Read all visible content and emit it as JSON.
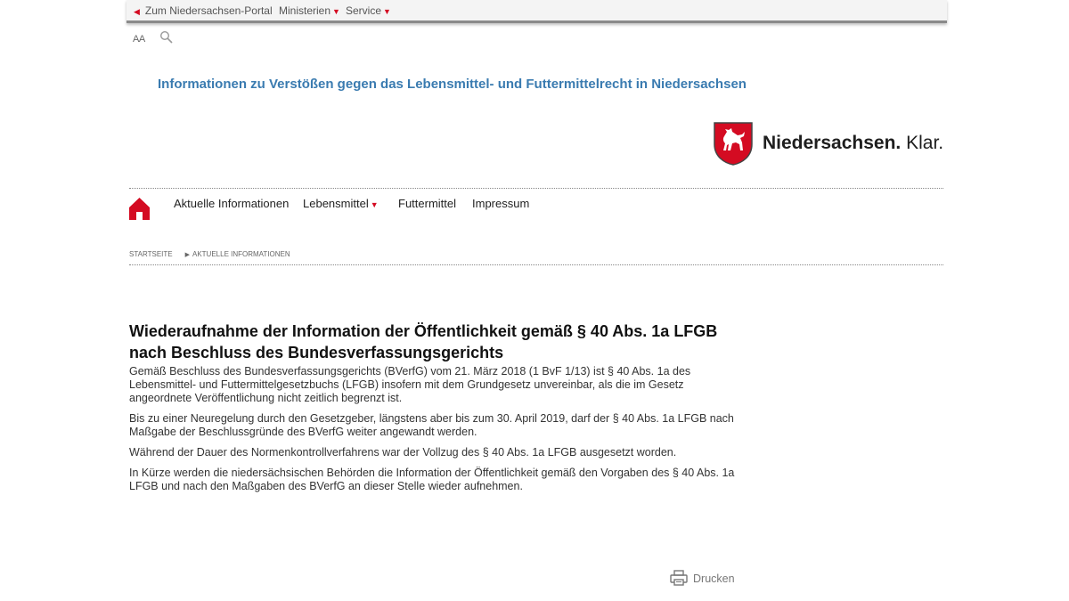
{
  "topbar": {
    "portal_label": "Zum Niedersachsen-Portal",
    "ministries_label": "Ministerien",
    "service_label": "Service"
  },
  "tools": {
    "font_size_label": "AA"
  },
  "site": {
    "tagline": "Informationen zu Verstößen gegen das Lebensmittel- und Futtermittelrecht in Niedersachsen",
    "logo_name": "Niedersachsen.",
    "logo_claim": "Klar."
  },
  "nav": {
    "items": [
      "Aktuelle Informationen",
      "Lebensmittel",
      "Futtermittel",
      "Impressum"
    ]
  },
  "breadcrumb": [
    "Startseite",
    "Aktuelle Informationen"
  ],
  "article": {
    "title": "Wiederaufnahme der Information der Öffentlichkeit gemäß § 40 Abs. 1a LFGB nach Beschluss des Bundesverfassungsgerichts",
    "paragraphs": [
      "Gemäß Beschluss des Bundesverfassungsgerichts (BVerfG) vom 21. März 2018 (1 BvF 1/13) ist § 40 Abs. 1a des Lebensmittel- und Futtermittelgesetzbuchs (LFGB) insofern mit dem Grundgesetz unvereinbar, als die im Gesetz angeordnete Veröffentlichung nicht zeitlich begrenzt ist.",
      "Bis zu einer Neuregelung durch den Gesetzgeber, längstens aber bis zum 30. April 2019, darf der § 40 Abs. 1a LFGB nach Maßgabe der Beschlussgründe des BVerfG weiter angewandt werden.",
      "Während der Dauer des Normenkontrollverfahrens war der Vollzug des § 40 Abs. 1a LFGB ausgesetzt worden.",
      "In Kürze werden die niedersächsischen Behörden die Information der Öffentlichkeit gemäß den Vorgaben des § 40 Abs. 1a LFGB und nach den Maßgaben des BVerfG an dieser Stelle wieder aufnehmen."
    ]
  },
  "actions": {
    "print_label": "Drucken"
  },
  "colors": {
    "accent_red": "#d40b22",
    "tagline_blue": "#3a7bb0"
  }
}
